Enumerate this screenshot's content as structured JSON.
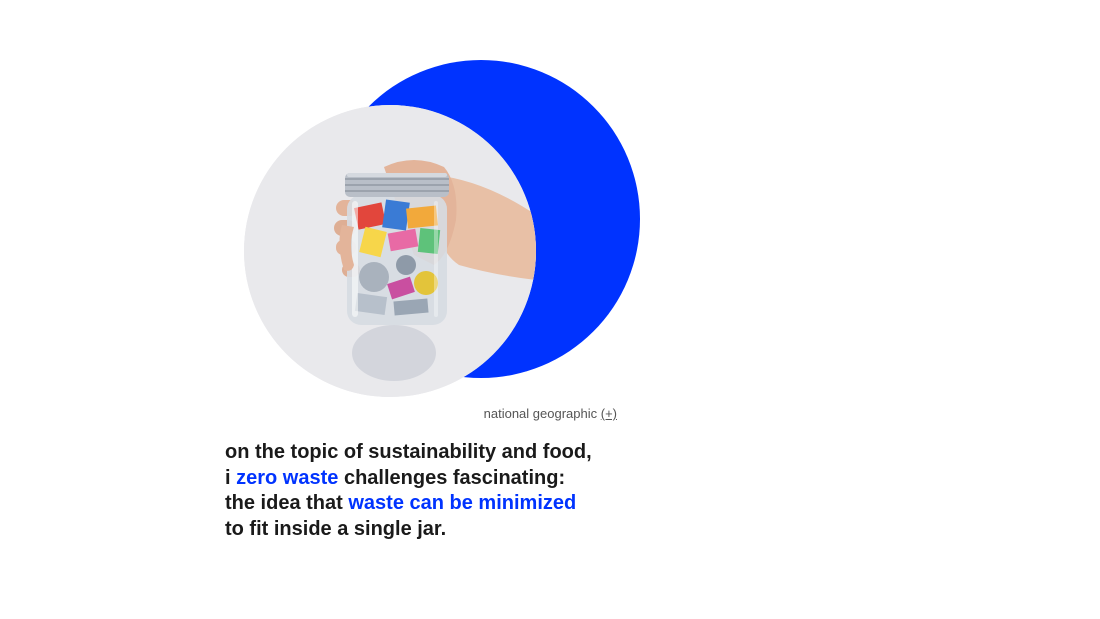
{
  "colors": {
    "accent": "#0033ff",
    "text": "#1a1a1a",
    "credit": "#555555",
    "photo_background": "#e9e9ec"
  },
  "image": {
    "subject": "hand holding a glass mason jar filled with trash"
  },
  "credit": {
    "source": "national geographic",
    "mark": "(+)"
  },
  "quote": {
    "line1": "on the topic of sustainability and food,",
    "line2_prefix": "i ",
    "line2_highlight": "zero waste",
    "line2_suffix": " challenges fascinating:",
    "line3_prefix": "the idea that ",
    "line3_highlight": "waste can be minimized",
    "line4": "to fit inside a single jar."
  }
}
